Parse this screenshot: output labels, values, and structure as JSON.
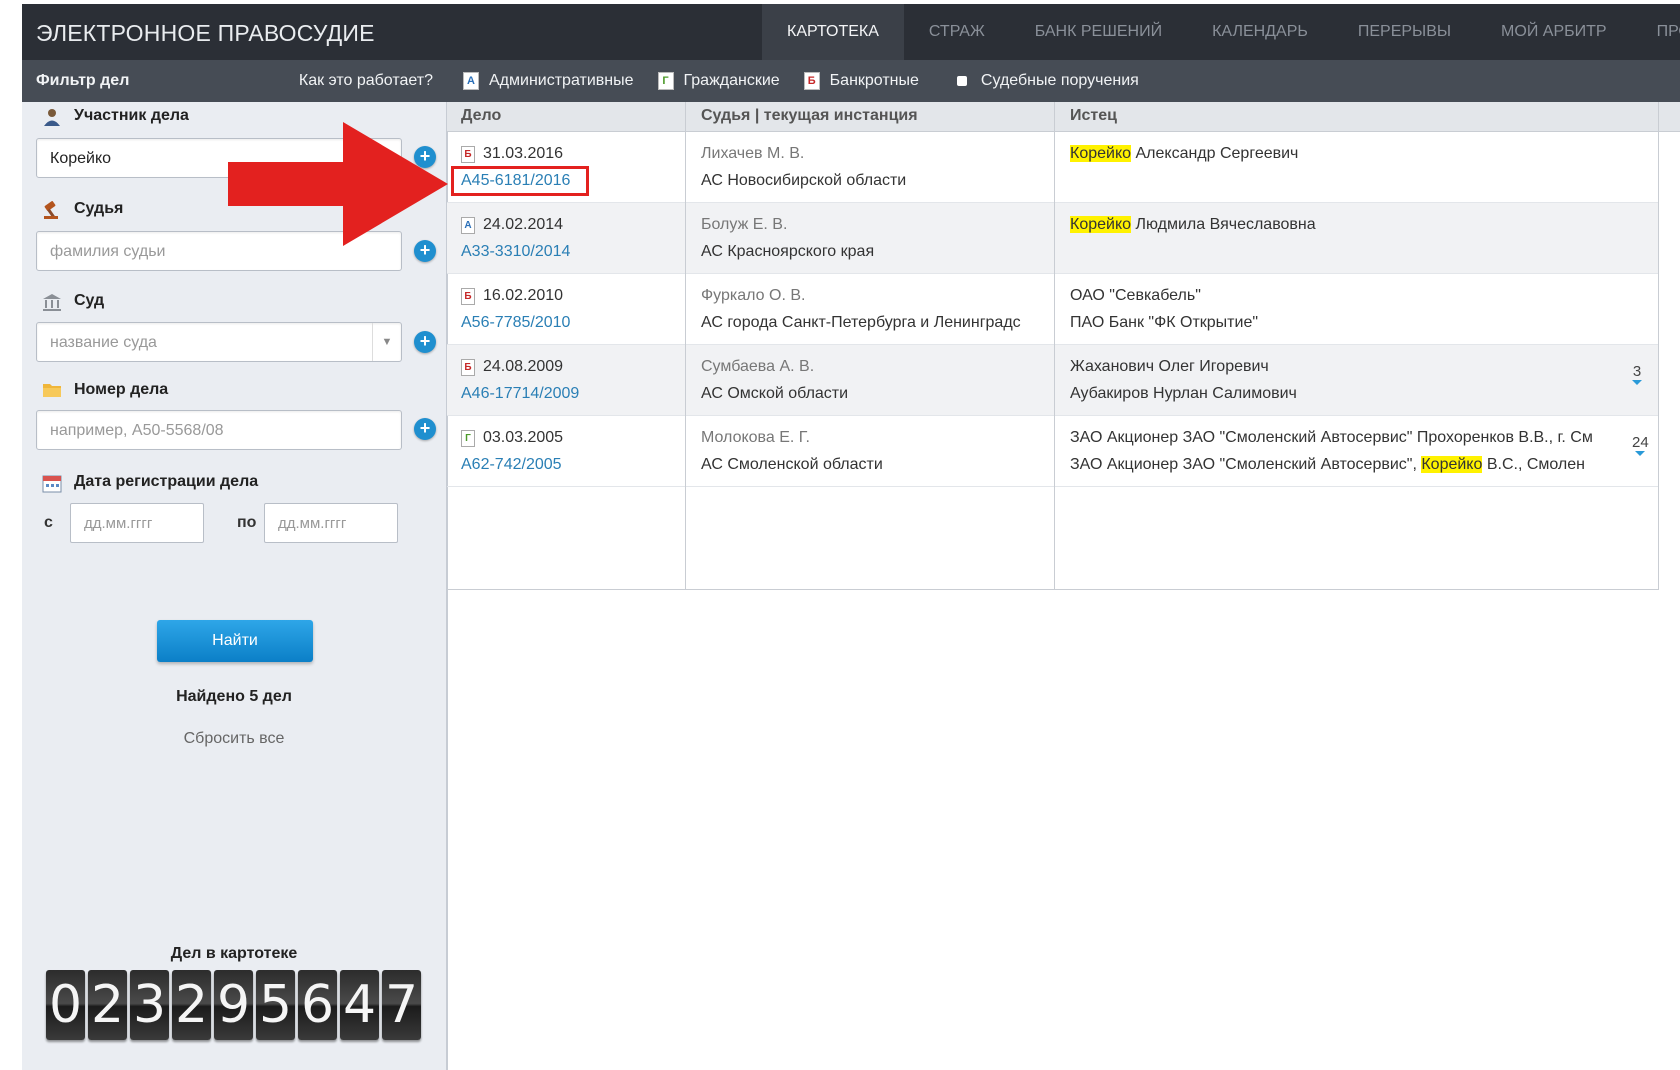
{
  "header": {
    "brand": "ЭЛЕКТРОННОЕ ПРАВОСУДИЕ",
    "nav": [
      "КАРТОТЕКА",
      "СТРАЖ",
      "БАНК РЕШЕНИЙ",
      "КАЛЕНДАРЬ",
      "ПЕРЕРЫВЫ",
      "МОЙ АРБИТР",
      "ПРО"
    ],
    "active_nav": "КАРТОТЕКА"
  },
  "filter": {
    "title": "Фильтр дел",
    "help": "Как это работает?",
    "participant_label": "Участник дела",
    "participant_value": "Корейко",
    "judge_label": "Судья",
    "judge_placeholder": "фамилия судьи",
    "court_label": "Суд",
    "court_placeholder": "название суда",
    "case_label": "Номер дела",
    "case_placeholder": "например, А50-5568/08",
    "date_label": "Дата регистрации дела",
    "date_from_label": "с",
    "date_to_label": "по",
    "date_placeholder": "дд.мм.гггг",
    "find_button": "Найти",
    "found_text": "Найдено 5 дел",
    "reset_text": "Сбросить все",
    "counter_label": "Дел в картотеке",
    "counter_digits": [
      "0",
      "2",
      "3",
      "2",
      "9",
      "5",
      "6",
      "4",
      "7"
    ]
  },
  "case_types": {
    "admin": {
      "icon": "А",
      "label": "Административные"
    },
    "civil": {
      "icon": "Г",
      "label": "Гражданские"
    },
    "bankrupt": {
      "icon": "Б",
      "label": "Банкротные"
    },
    "orders": {
      "label": "Судебные поручения"
    }
  },
  "table": {
    "headers": {
      "case": "Дело",
      "judge": "Судья | текущая инстанция",
      "plaintiff": "Истец"
    },
    "rows": [
      {
        "type": "Б",
        "date": "31.03.2016",
        "number": "А45-6181/2016",
        "judge": "Лихачев М. В.",
        "court": "АС Новосибирской области",
        "plaintiff_hl": "Корейко",
        "plaintiff_rest": " Александр Сергеевич"
      },
      {
        "type": "А",
        "date": "24.02.2014",
        "number": "А33-3310/2014",
        "judge": "Болуж Е. В.",
        "court": "АС Красноярского края",
        "plaintiff_hl": "Корейко",
        "plaintiff_rest": " Людмила Вячеславовна"
      },
      {
        "type": "Б",
        "date": "16.02.2010",
        "number": "А56-7785/2010",
        "judge": "Фуркало О. В.",
        "court": "АС города Санкт-Петербурга и Ленинградс",
        "plaintiff1": "ОАО \"Севкабель\"",
        "plaintiff2": "ПАО Банк \"ФК Открытие\""
      },
      {
        "type": "Б",
        "date": "24.08.2009",
        "number": "А46-17714/2009",
        "judge": "Сумбаева А. В.",
        "court": "АС Омской области",
        "plaintiff1": "Жаханович Олег Игоревич",
        "plaintiff2": "Аубакиров Нурлан Салимович",
        "more": "3"
      },
      {
        "type": "Г",
        "date": "03.03.2005",
        "number": "А62-742/2005",
        "judge": "Молокова Е. Г.",
        "court": "АС Смоленской области",
        "plaintiff1": "ЗАО Акционер ЗАО \"Смоленский Автосервис\" Прохоренков В.В., г. См",
        "plaintiff2_pre": "ЗАО Акционер ЗАО \"Смоленский Автосервис\", ",
        "plaintiff2_hl": "Корейко",
        "plaintiff2_post": " В.С., Смолен",
        "more": "24"
      }
    ]
  },
  "colors": {
    "accent": "#1f8fcf",
    "highlight": "#fff200",
    "annotation": "#e3211f",
    "topbar": "#2b2f36"
  }
}
